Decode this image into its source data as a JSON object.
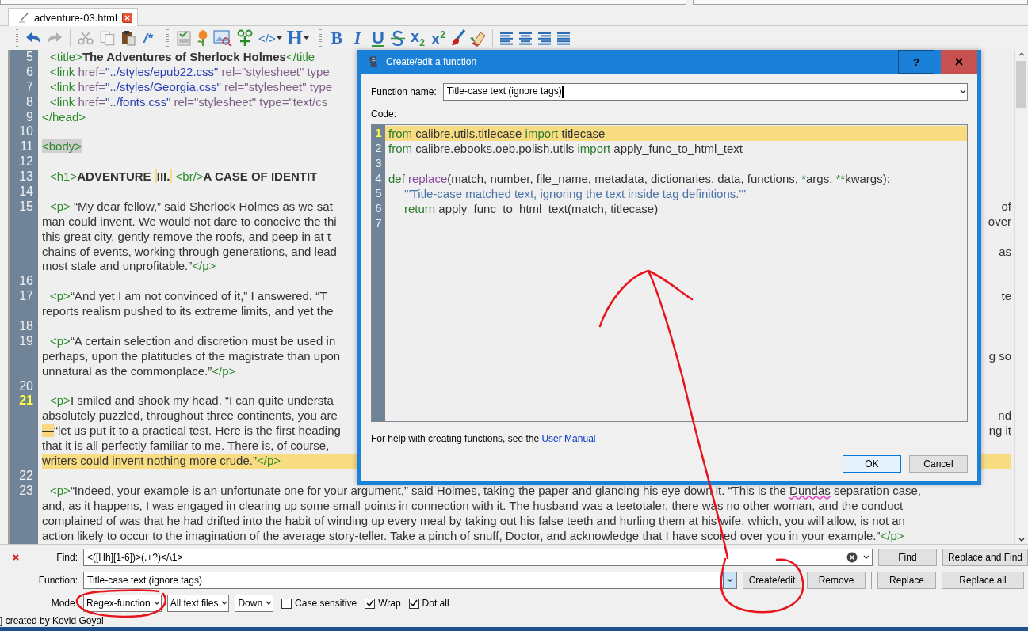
{
  "tabs": [
    {
      "label": "adventure-03.html",
      "selected": true
    }
  ],
  "toolbars": [
    [
      {
        "kind": "undo",
        "disabled": false
      },
      {
        "kind": "redo",
        "disabled": true
      },
      {
        "kind": "separator"
      },
      {
        "kind": "cut",
        "disabled": true
      },
      {
        "kind": "copy",
        "disabled": true
      },
      {
        "kind": "paste",
        "disabled": false
      },
      {
        "kind": "comment",
        "label": "/*",
        "disabled": false
      }
    ],
    [
      {
        "kind": "page",
        "disabled": false
      },
      {
        "kind": "flower",
        "disabled": false
      },
      {
        "kind": "image",
        "disabled": false
      },
      {
        "kind": "insert",
        "disabled": false
      },
      {
        "kind": "tag",
        "label": "</>",
        "menu": true,
        "disabled": false
      },
      {
        "kind": "heading",
        "label": "H",
        "menu": true,
        "disabled": false
      }
    ],
    [
      {
        "kind": "bold",
        "label": "B",
        "disabled": false
      },
      {
        "kind": "italic",
        "label": "I",
        "disabled": false
      },
      {
        "kind": "underline",
        "label": "U",
        "disabled": false
      },
      {
        "kind": "strike",
        "disabled": false
      },
      {
        "kind": "script",
        "label": "x$_{2}$",
        "disabled": false
      },
      {
        "kind": "script",
        "label": "x$^{2}$",
        "disabled": false
      },
      {
        "kind": "brush",
        "disabled": false
      },
      {
        "kind": "eraser",
        "disabled": false
      },
      {
        "kind": "separator"
      },
      {
        "kind": "align-left",
        "disabled": false
      },
      {
        "kind": "align-center",
        "disabled": false
      },
      {
        "kind": "align-right",
        "disabled": false
      },
      {
        "kind": "align-justify",
        "disabled": false
      }
    ]
  ],
  "editor": {
    "lines": [
      {
        "number": "5",
        "current": false,
        "indent": true,
        "rows": [
          {
            "segments": [
              {
                "kind": "tag",
                "text": "<title>"
              },
              {
                "kind": "bold",
                "text": "The Adventures of Sherlock Holmes"
              },
              {
                "kind": "tag",
                "text": "</title"
              }
            ]
          }
        ]
      },
      {
        "number": "6",
        "current": false,
        "indent": true,
        "rows": [
          {
            "segments": [
              {
                "kind": "tag",
                "text": "<link"
              },
              {
                "kind": "attr",
                "text": " href="
              },
              {
                "kind": "string",
                "text": "\"../styles/epub22.css\""
              },
              {
                "kind": "attr",
                "text": " rel=\"stylesheet\" type"
              }
            ]
          }
        ]
      },
      {
        "number": "7",
        "current": false,
        "indent": true,
        "rows": [
          {
            "segments": [
              {
                "kind": "tag",
                "text": "<link"
              },
              {
                "kind": "attr",
                "text": " href="
              },
              {
                "kind": "string",
                "text": "\"../styles/Georgia.css\""
              },
              {
                "kind": "attr",
                "text": " rel=\"stylesheet\" type"
              }
            ]
          }
        ]
      },
      {
        "number": "8",
        "current": false,
        "indent": true,
        "rows": [
          {
            "segments": [
              {
                "kind": "tag",
                "text": "<link"
              },
              {
                "kind": "attr",
                "text": " href="
              },
              {
                "kind": "string",
                "text": "\"../fonts.css\""
              },
              {
                "kind": "attr",
                "text": " rel=\"stylesheet\" type=\"text/cs"
              }
            ]
          }
        ]
      },
      {
        "number": "9",
        "current": false,
        "indent": false,
        "rows": [
          {
            "segments": [
              {
                "kind": "tag",
                "text": "</head>"
              }
            ]
          }
        ]
      },
      {
        "number": "10",
        "current": false,
        "rows": [
          {}
        ]
      },
      {
        "number": "11",
        "current": false,
        "indent": false,
        "rows": [
          {
            "segments": [
              {
                "kind": "tag",
                "text": "<body>",
                "highlight": true
              }
            ]
          }
        ]
      },
      {
        "number": "12",
        "current": false,
        "rows": [
          {}
        ]
      },
      {
        "number": "13",
        "current": false,
        "indent": true,
        "rows": [
          {
            "segments": [
              {
                "kind": "tag",
                "text": "<h1>"
              },
              {
                "kind": "bold",
                "text": "ADVENTURE "
              },
              {
                "kind": "bold",
                "text": "III.",
                "highlight": true
              },
              {
                "kind": "tag",
                "text": " <br/>"
              },
              {
                "kind": "bold",
                "text": "A CASE OF IDENTIT"
              }
            ]
          }
        ]
      },
      {
        "number": "14",
        "current": false,
        "rows": [
          {}
        ]
      },
      {
        "number": "15",
        "current": false,
        "indent": true,
        "rows": [
          {
            "segments": [
              {
                "kind": "tag",
                "text": "<p>"
              },
              {
                "kind": "text",
                "text": " “My dear fellow,” said Sherlock Holmes as we sat"
              }
            ],
            "right": "of"
          },
          {
            "segments": [
              {
                "kind": "text",
                "text": "man could invent. We would not dare to conceive the thi"
              }
            ],
            "right": "over"
          },
          {
            "segments": [
              {
                "kind": "text",
                "text": "this great city, gently remove the roofs, and peep in at t"
              }
            ]
          },
          {
            "segments": [
              {
                "kind": "text",
                "text": "chains of events, working through generations, and lead"
              }
            ],
            "right": "as"
          },
          {
            "segments": [
              {
                "kind": "text",
                "text": "most stale and unprofitable.”"
              },
              {
                "kind": "tag",
                "text": "</p>"
              }
            ]
          }
        ]
      },
      {
        "number": "16",
        "current": false,
        "rows": [
          {}
        ]
      },
      {
        "number": "17",
        "current": false,
        "indent": true,
        "rows": [
          {
            "segments": [
              {
                "kind": "tag",
                "text": "<p>"
              },
              {
                "kind": "text",
                "text": "“And yet I am not convinced of it,” I answered. “T"
              }
            ],
            "right": "te"
          },
          {
            "segments": [
              {
                "kind": "text",
                "text": "reports realism pushed to its extreme limits, and yet the"
              }
            ]
          }
        ]
      },
      {
        "number": "18",
        "current": false,
        "rows": [
          {}
        ]
      },
      {
        "number": "19",
        "current": false,
        "indent": true,
        "rows": [
          {
            "segments": [
              {
                "kind": "tag",
                "text": "<p>"
              },
              {
                "kind": "text",
                "text": "“A certain selection and discretion must be used in"
              }
            ]
          },
          {
            "segments": [
              {
                "kind": "text",
                "text": "perhaps, upon the platitudes of the magistrate than upon"
              }
            ],
            "right": "g so"
          },
          {
            "segments": [
              {
                "kind": "text",
                "text": "unnatural as the commonplace.”"
              },
              {
                "kind": "tag",
                "text": "</p>"
              }
            ]
          }
        ]
      },
      {
        "number": "20",
        "current": false,
        "rows": [
          {}
        ]
      },
      {
        "number": "21",
        "current": true,
        "indent": true,
        "rows": [
          {
            "segments": [
              {
                "kind": "tag",
                "text": "<p>"
              },
              {
                "kind": "text",
                "text": "I smiled and shook my head. “I can quite understa"
              }
            ]
          },
          {
            "segments": [
              {
                "kind": "text",
                "text": "absolutely puzzled, throughout three continents, you are"
              }
            ],
            "right": "nd"
          },
          {
            "segments": [
              {
                "kind": "text",
                "text": "—",
                "highlight": true
              },
              {
                "kind": "text",
                "text": "“let us put it to a practical test. Here is the first heading"
              }
            ],
            "right": "ng it"
          },
          {
            "segments": [
              {
                "kind": "text",
                "text": "that it is all perfectly familiar to me. There is, of course,"
              }
            ]
          },
          {
            "segments": [
              {
                "kind": "text",
                "text": "writers could invent nothing more crude.”"
              },
              {
                "kind": "tag",
                "text": "</p>"
              }
            ],
            "highlight": true
          }
        ]
      },
      {
        "number": "22",
        "current": false,
        "rows": [
          {}
        ]
      },
      {
        "number": "23",
        "current": false,
        "indent": true,
        "rows": [
          {
            "segments": [
              {
                "kind": "tag",
                "text": "<p>"
              },
              {
                "kind": "text",
                "text": "“Indeed, your example is an unfortunate one for your argument,” said Holmes, taking the paper and glancing his eye down it. “This is the "
              },
              {
                "kind": "misspelled",
                "text": "Dundas"
              },
              {
                "kind": "text",
                "text": " separation case,"
              }
            ]
          },
          {
            "segments": [
              {
                "kind": "text",
                "text": "and, as it happens, I was engaged in clearing up some small points in connection with it. The husband was a teetotaler, there was no other woman, and the conduct"
              }
            ]
          },
          {
            "segments": [
              {
                "kind": "text",
                "text": "complained of was that he had drifted into the habit of winding up every meal by taking out his false teeth and hurling them at his wife, which, you will allow, is not an"
              }
            ]
          },
          {
            "segments": [
              {
                "kind": "text",
                "text": "action likely to occur to the imagination of the average story-teller. Take a pinch of snuff, Doctor, and acknowledge that I have scored over you in your example.”"
              },
              {
                "kind": "tag",
                "text": "</p>"
              }
            ]
          }
        ]
      }
    ]
  },
  "dialog": {
    "title": "Create/edit a function",
    "help_button": "?",
    "function_name": {
      "label": "Function name:",
      "value": "Title-case text (ignore tags)"
    },
    "code_label": "Code:",
    "code_lines": [
      {
        "number": "1",
        "current": true,
        "indent": false,
        "segments": [
          {
            "kind": "keyword",
            "text": "from"
          },
          {
            "kind": "text",
            "text": " calibre.utils.titlecase "
          },
          {
            "kind": "keyword",
            "text": "import"
          },
          {
            "kind": "text",
            "text": " titlecase"
          }
        ]
      },
      {
        "number": "2",
        "current": false,
        "indent": false,
        "segments": [
          {
            "kind": "keyword",
            "text": "from"
          },
          {
            "kind": "text",
            "text": " calibre.ebooks.oeb.polish.utils "
          },
          {
            "kind": "keyword",
            "text": "import"
          },
          {
            "kind": "text",
            "text": " apply_func_to_html_text"
          }
        ]
      },
      {
        "number": "3",
        "current": false
      },
      {
        "number": "4",
        "current": false,
        "indent": false,
        "segments": [
          {
            "kind": "keyword",
            "text": "def"
          },
          {
            "kind": "function",
            "text": " replace"
          },
          {
            "kind": "text",
            "text": "(match, number, file_name, metadata, dictionaries, data, functions, "
          },
          {
            "kind": "keyword",
            "text": "*"
          },
          {
            "kind": "text",
            "text": "args, "
          },
          {
            "kind": "keyword",
            "text": "**"
          },
          {
            "kind": "text",
            "text": "kwargs):"
          }
        ]
      },
      {
        "number": "5",
        "current": false,
        "indent": true,
        "segments": [
          {
            "kind": "docstring",
            "text": "'''Title-case matched text, ignoring the text inside tag definitions.'''"
          }
        ]
      },
      {
        "number": "6",
        "current": false,
        "indent": true,
        "segments": [
          {
            "kind": "keyword",
            "text": "return"
          },
          {
            "kind": "text",
            "text": " apply_func_to_html_text(match, titlecase)"
          }
        ]
      },
      {
        "number": "7",
        "current": false
      }
    ],
    "help_text": "For help with creating functions, see the",
    "help_link": "User Manual",
    "buttons": [
      {
        "label": "OK",
        "default": true
      },
      {
        "label": "Cancel",
        "default": false
      }
    ]
  },
  "find_panel": {
    "find": {
      "label": "Find:",
      "value": "<([Hh][1-6])>(.+?)</\\1>"
    },
    "function": {
      "label": "Function:",
      "value": "Title-case text (ignore tags)"
    },
    "mode": {
      "label": "Mode:"
    },
    "dropdowns": [
      {
        "value": "Regex-function"
      },
      {
        "value": "All text files"
      },
      {
        "value": "Down"
      }
    ],
    "options": [
      {
        "label": "Case sensitive",
        "checked": false
      },
      {
        "label": "Wrap",
        "checked": true
      },
      {
        "label": "Dot all",
        "checked": true
      }
    ],
    "buttons": [
      {
        "label": "Find"
      },
      {
        "label": "Replace and Find"
      },
      {
        "label": "Create/edit"
      },
      {
        "label": "Remove"
      },
      {
        "label": "Replace"
      },
      {
        "label": "Replace all"
      }
    ]
  },
  "status_bar": {
    "text": "] created by Kovid Goyal"
  },
  "annotations": [
    {
      "kind": "loop"
    },
    {
      "kind": "arrow"
    },
    {
      "kind": "loop"
    }
  ]
}
